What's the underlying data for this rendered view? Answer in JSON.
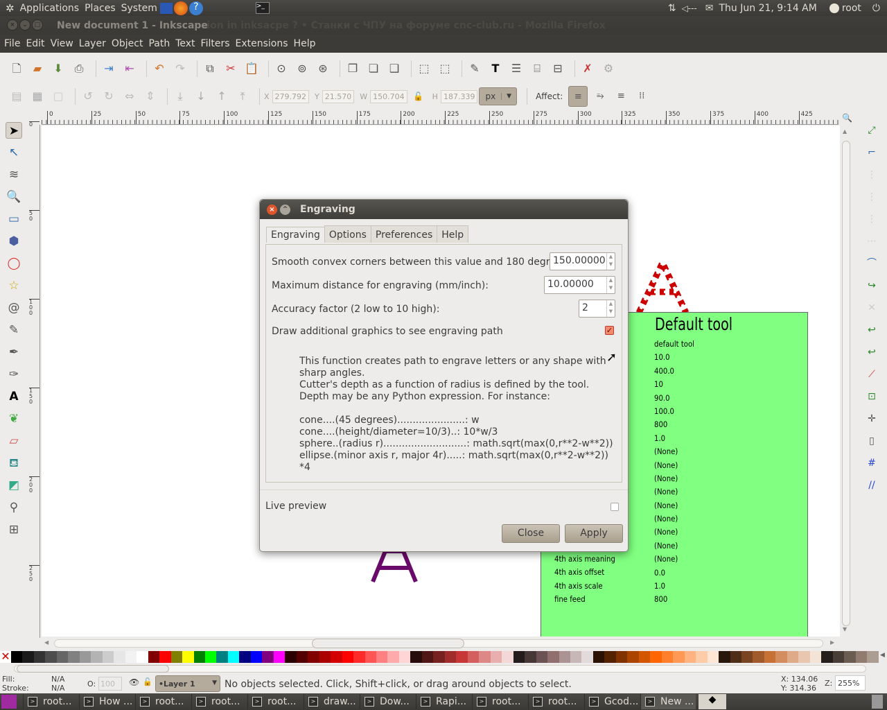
{
  "top_panel": {
    "menus": [
      "Applications",
      "Places",
      "System"
    ],
    "clock": "Thu Jun 21,  9:14 AM",
    "user": "root"
  },
  "window": {
    "title": "New document 1 - Inkscape",
    "behind_title": "sion in inksacpe ? • Станки с ЧПУ на форуме cnc-club.ru - Mozilla Firefox"
  },
  "menu": [
    "File",
    "Edit",
    "View",
    "Layer",
    "Object",
    "Path",
    "Text",
    "Filters",
    "Extensions",
    "Help"
  ],
  "selector_bar": {
    "x_label": "X",
    "x": "279.792",
    "y_label": "Y",
    "y": "21.570",
    "w_label": "W",
    "w": "150.704",
    "h_label": "H",
    "h": "187.339",
    "unit": "px",
    "affect_label": "Affect:"
  },
  "ruler_ticks": [
    "0",
    "25",
    "50",
    "75",
    "100",
    "125",
    "150",
    "175",
    "200",
    "225",
    "250",
    "275",
    "300",
    "325",
    "350",
    "375",
    "400",
    "425"
  ],
  "left_ruler_ticks": [
    "0",
    "5\n0",
    "1\n0\n0",
    "1\n5\n0",
    "2\n0\n0",
    "2\n5\n0"
  ],
  "tool_table": {
    "title": "Default tool",
    "labels": [
      "4th axis meaning",
      "4th axis offset",
      "4th axis scale",
      "fine feed"
    ],
    "values": [
      "default tool",
      "10.0",
      "400.0",
      "10",
      "90.0",
      "100.0",
      "800",
      "1.0",
      "(None)",
      "(None)",
      "(None)",
      "(None)",
      "(None)",
      "(None)",
      "(None)",
      "(None)",
      "(None)",
      "0.0",
      "1.0",
      "800"
    ]
  },
  "dialog": {
    "title": "Engraving",
    "tabs": [
      "Engraving",
      "Options",
      "Preferences",
      "Help"
    ],
    "smooth_label": "Smooth convex corners between this value and 180 degrees:",
    "smooth_value": "150.00000",
    "maxdist_label": "Maximum distance for engraving (mm/inch):",
    "maxdist_value": "10.00000",
    "accuracy_label": "Accuracy factor (2 low to 10 high):",
    "accuracy_value": "2",
    "draw_label": "Draw additional graphics to see engraving path",
    "draw_checked": true,
    "description": "This function creates path to engrave letters or any shape with\nsharp angles.\nCutter's depth as a function of radius is defined by the tool.\nDepth may be any Python expression. For instance:\n\ncone....(45 degrees)......................: w\ncone....(height/diameter=10/3)..: 10*w/3\nsphere..(radius r)...........................: math.sqrt(max(0,r**2-w**2))\nellipse.(minor axis r, major 4r).....: math.sqrt(max(0,r**2-w**2))\n*4",
    "live_preview_label": "Live preview",
    "live_preview_checked": false,
    "close_label": "Close",
    "apply_label": "Apply"
  },
  "palette": [
    "#000000",
    "#1a1a1a",
    "#333333",
    "#4d4d4d",
    "#666666",
    "#808080",
    "#999999",
    "#b3b3b3",
    "#cccccc",
    "#e6e6e6",
    "#f2f2f2",
    "#ffffff",
    "#800000",
    "#ff0000",
    "#808000",
    "#ffff00",
    "#008000",
    "#00ff00",
    "#008080",
    "#00ffff",
    "#000080",
    "#0000ff",
    "#800080",
    "#ff00ff",
    "#2b0000",
    "#550000",
    "#800000",
    "#aa0000",
    "#d40000",
    "#ff0000",
    "#ff2a2a",
    "#ff5555",
    "#ff8080",
    "#ffaaaa",
    "#ffd5d5",
    "#280b0b",
    "#501616",
    "#782121",
    "#a02c2c",
    "#c83737",
    "#d35f5f",
    "#de8787",
    "#e9afaf",
    "#f4d7d7",
    "#241c1c",
    "#483737",
    "#6c5353",
    "#916f6f",
    "#ac9393",
    "#c8b7b7",
    "#e3dbdb",
    "#2b1100",
    "#552200",
    "#803300",
    "#aa4400",
    "#d45500",
    "#ff6600",
    "#ff7f2a",
    "#ff9955",
    "#ffb380",
    "#ffccaa",
    "#ffe6d5",
    "#28170b",
    "#502d16",
    "#784421",
    "#a05a2c",
    "#c87137",
    "#d38d5f",
    "#deaa87",
    "#e9c6af",
    "#f4e3d7",
    "#241f1c",
    "#483e37",
    "#6c5d53",
    "#917c6f",
    "#ac9d93"
  ],
  "status": {
    "fill_label": "Fill:",
    "fill": "N/A",
    "stroke_label": "Stroke:",
    "stroke": "N/A",
    "opacity_label": "O:",
    "opacity": "100",
    "layer": "•Layer 1",
    "message": "No objects selected. Click, Shift+click, or drag around objects to select.",
    "cursor_x": "134.06",
    "cursor_y": "314.36",
    "zoom_label": "Z:",
    "zoom": "255%"
  },
  "taskbar": [
    "root...",
    "How ...",
    "root...",
    "root...",
    "root...",
    "draw...",
    "Dow...",
    "Rapi...",
    "root...",
    "root...",
    "Gcod...",
    "New ..."
  ]
}
